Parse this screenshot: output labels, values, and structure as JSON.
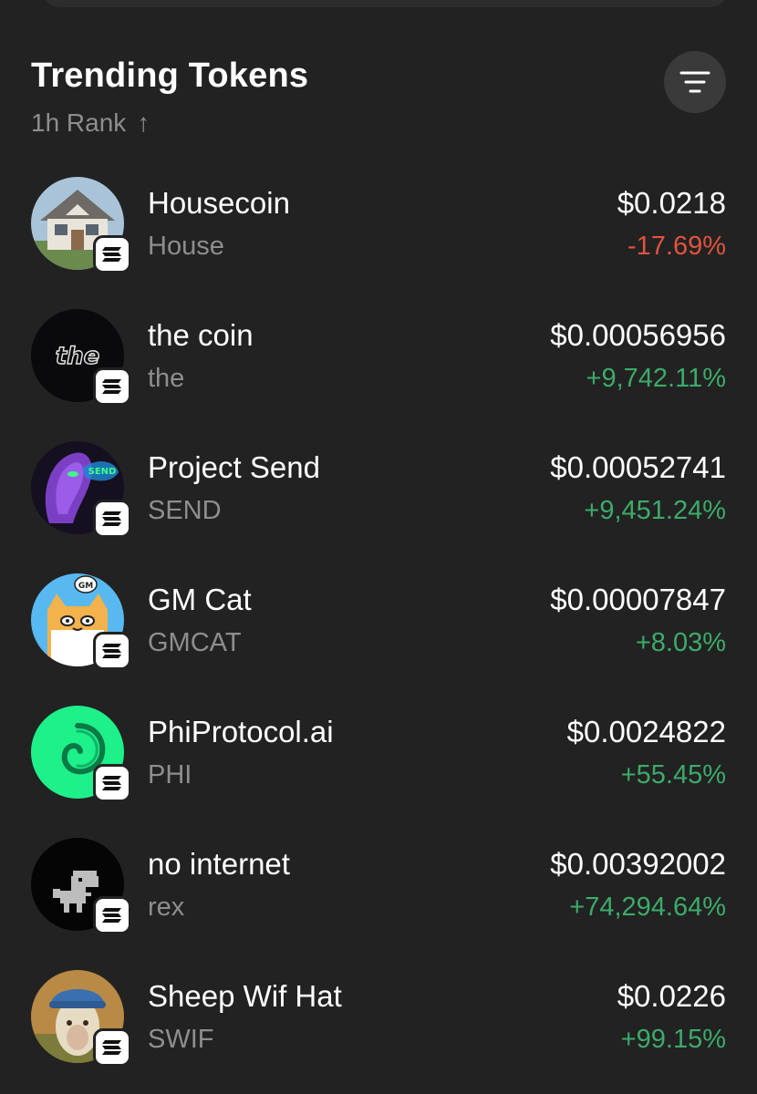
{
  "header": {
    "title": "Trending Tokens",
    "sort_label": "1h Rank",
    "sort_arrow": "↑"
  },
  "colors": {
    "background": "#222222",
    "negative": "#e0533d",
    "positive": "#3cab6a",
    "muted": "#8e8e8e"
  },
  "tokens": [
    {
      "name": "Housecoin",
      "symbol": "House",
      "price": "$0.0218",
      "change": "-17.69%",
      "direction": "down",
      "avatar_icon": "house-icon"
    },
    {
      "name": "the coin",
      "symbol": "the",
      "price": "$0.00056956",
      "change": "+9,742.11%",
      "direction": "up",
      "avatar_icon": "the-logo-icon",
      "avatar_text": "the"
    },
    {
      "name": "Project Send",
      "symbol": "SEND",
      "price": "$0.00052741",
      "change": "+9,451.24%",
      "direction": "up",
      "avatar_icon": "robot-head-icon",
      "avatar_text": "SEND"
    },
    {
      "name": "GM Cat",
      "symbol": "GMCAT",
      "price": "$0.00007847",
      "change": "+8.03%",
      "direction": "up",
      "avatar_icon": "cat-icon",
      "avatar_text": "GM"
    },
    {
      "name": "PhiProtocol.ai",
      "symbol": "PHI",
      "price": "$0.0024822",
      "change": "+55.45%",
      "direction": "up",
      "avatar_icon": "spiral-icon"
    },
    {
      "name": "no internet",
      "symbol": "rex",
      "price": "$0.00392002",
      "change": "+74,294.64%",
      "direction": "up",
      "avatar_icon": "dino-icon"
    },
    {
      "name": "Sheep Wif Hat",
      "symbol": "SWIF",
      "price": "$0.0226",
      "change": "+99.15%",
      "direction": "up",
      "avatar_icon": "sheep-icon"
    }
  ]
}
